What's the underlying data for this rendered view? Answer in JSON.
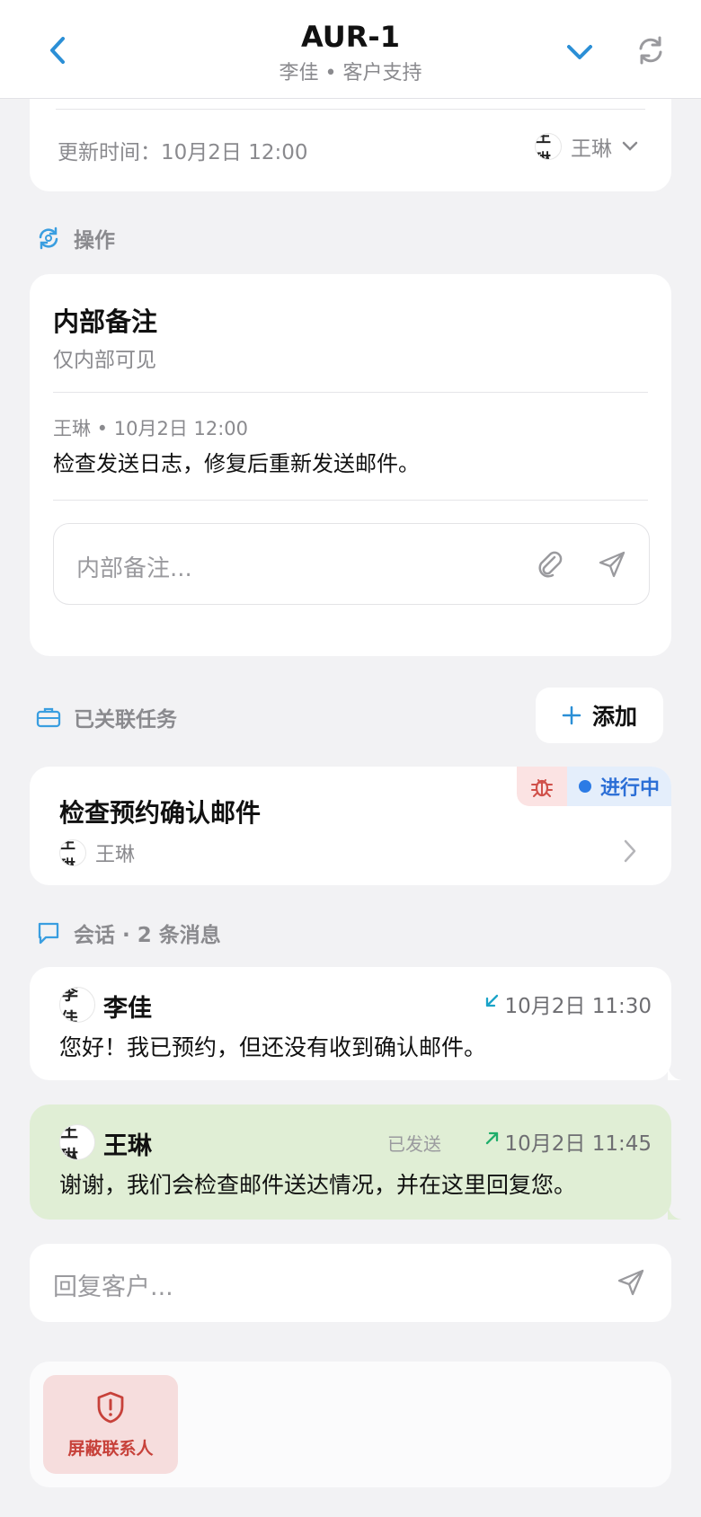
{
  "header": {
    "title": "AUR-1",
    "subtitle": "李佳 • 客户支持"
  },
  "ticket_info": {
    "updated_label": "更新时间：10月2日 12:00",
    "assignee": "王琳",
    "assignee_avatar": "王琳"
  },
  "actions_section": {
    "label": "操作"
  },
  "internal_notes": {
    "title": "内部备注",
    "subtitle": "仅内部可见",
    "note_meta": "王琳 • 10月2日 12:00",
    "note_text": "检查发送日志，修复后重新发送邮件。",
    "input_placeholder": "内部备注..."
  },
  "linked_tasks": {
    "label": "已关联任务",
    "add_label": "添加",
    "tasks": [
      {
        "title": "检查预约确认邮件",
        "assignee": "王琳",
        "avatar": "王琳",
        "status": "进行中",
        "type_icon": "bug-icon"
      }
    ]
  },
  "conversation": {
    "label": "会话 · 2 条消息",
    "messages": [
      {
        "sender": "李佳",
        "avatar": "李佳",
        "time": "10月2日 11:30",
        "direction": "incoming",
        "text": "您好！我已预约，但还没有收到确认邮件。"
      },
      {
        "sender": "王琳",
        "avatar": "王琳",
        "time": "10月2日 11:45",
        "direction": "outgoing",
        "status": "已发送",
        "text": "谢谢，我们会检查邮件送达情况，并在这里回复您。"
      }
    ]
  },
  "reply": {
    "placeholder": "回复客户..."
  },
  "footer": {
    "block_label": "屏蔽联系人"
  },
  "colors": {
    "accent": "#2b8fd6",
    "outgoing_bg": "#e0eed5",
    "status_blue": "#2c6fd6",
    "danger": "#c7413a"
  }
}
